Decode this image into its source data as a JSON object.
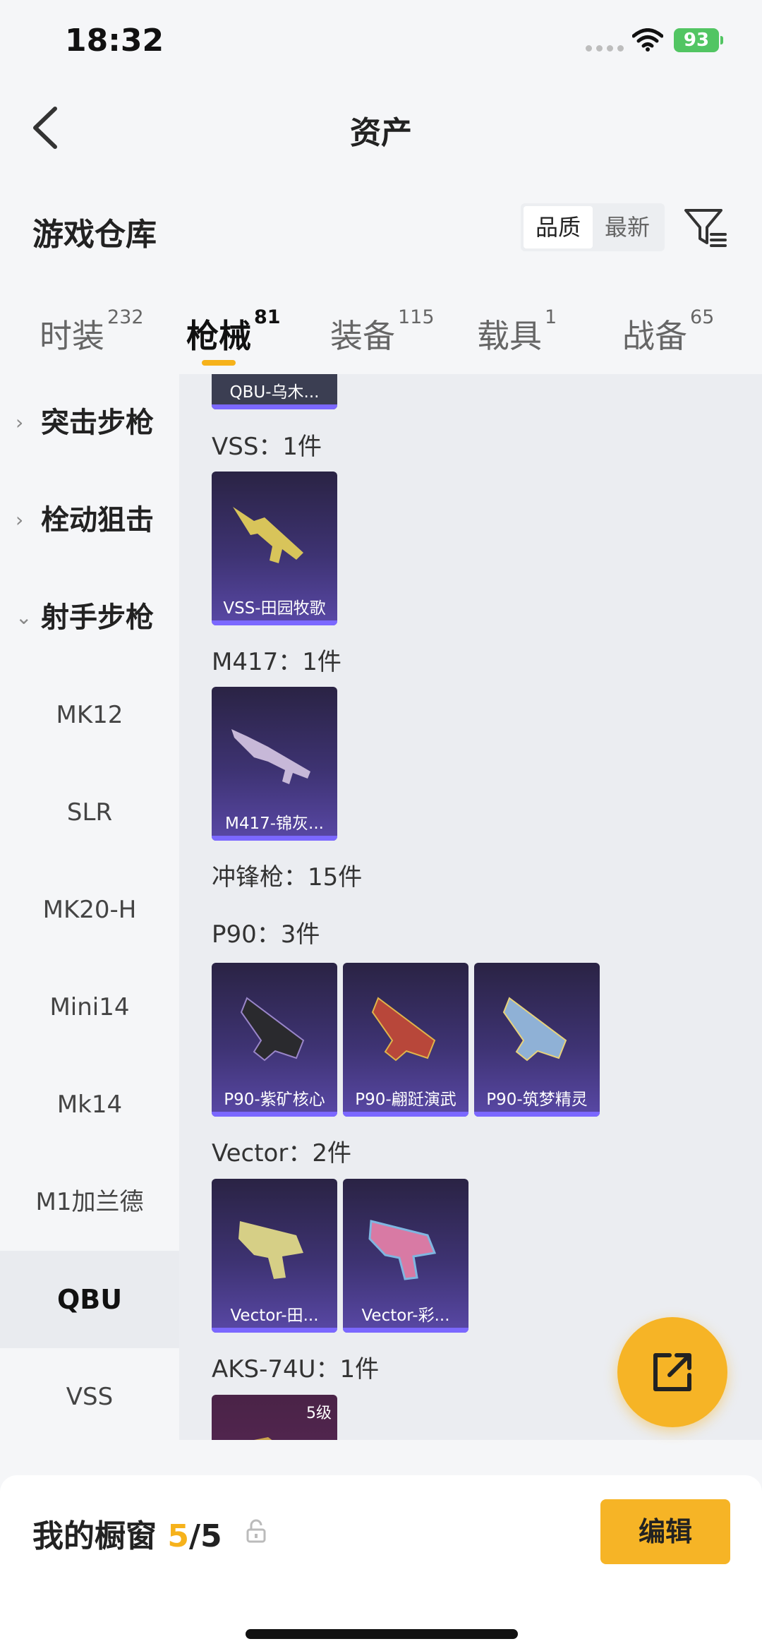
{
  "status_bar": {
    "time": "18:32",
    "battery": "93"
  },
  "nav": {
    "title": "资产"
  },
  "section": {
    "title": "游戏仓库",
    "sort_options": [
      "品质",
      "最新"
    ],
    "sort_selected": "品质"
  },
  "tabs": [
    {
      "label": "时装",
      "count": "232"
    },
    {
      "label": "枪械",
      "count": "81"
    },
    {
      "label": "装备",
      "count": "115"
    },
    {
      "label": "载具",
      "count": "1"
    },
    {
      "label": "战备",
      "count": "65"
    }
  ],
  "sidebar": {
    "groups": [
      {
        "label": "突击步枪",
        "expanded": false
      },
      {
        "label": "栓动狙击",
        "expanded": false
      },
      {
        "label": "射手步枪",
        "expanded": true
      }
    ],
    "items": [
      "MK12",
      "SLR",
      "MK20-H",
      "Mini14",
      "Mk14",
      "M1加兰德",
      "QBU",
      "VSS"
    ],
    "selected": "QBU"
  },
  "content": {
    "top_partial_card": "QBU-乌木...",
    "groups": [
      {
        "label": "VSS：1件",
        "cards": [
          "VSS-田园牧歌"
        ]
      },
      {
        "label": "M417：1件",
        "cards": [
          "M417-锦灰..."
        ]
      },
      {
        "label": "冲锋枪：15件",
        "cards": []
      },
      {
        "label": "P90：3件",
        "cards": [
          "P90-紫矿核心",
          "P90-翩跹演武",
          "P90-筑梦精灵"
        ]
      },
      {
        "label": "Vector：2件",
        "cards": [
          "Vector-田...",
          "Vector-彩..."
        ]
      },
      {
        "label": "AKS-74U：1件",
        "cards": [
          ""
        ],
        "level": "5级"
      }
    ]
  },
  "bottom": {
    "showcase_label": "我的橱窗",
    "showcase_used": "5",
    "showcase_total": "/5",
    "edit_label": "编辑"
  },
  "colors": {
    "accent": "#f6b426",
    "card_bg": "#3e3373",
    "card_stripe": "#7b68ff"
  },
  "icons": [
    "back-icon",
    "filter-icon",
    "wifi-icon",
    "share-icon",
    "lock-icon",
    "chevron-right-icon",
    "chevron-down-icon"
  ]
}
